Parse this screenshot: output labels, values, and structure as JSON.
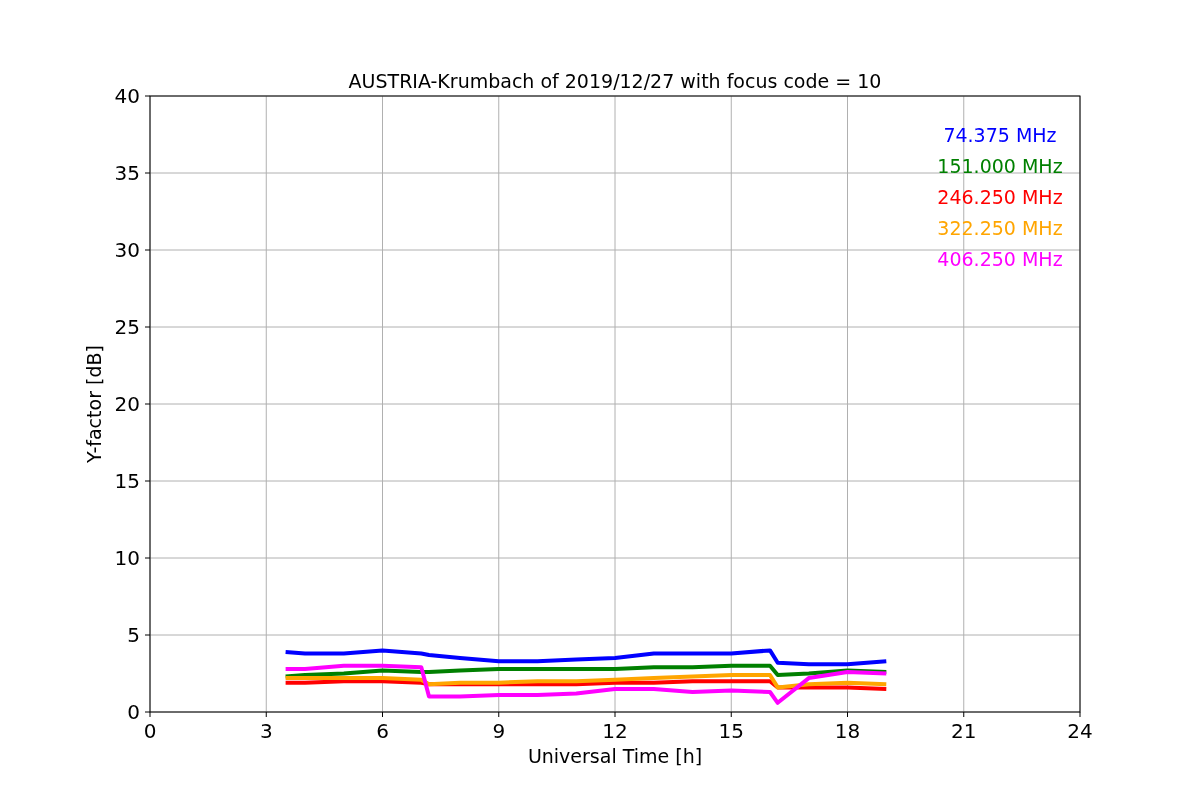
{
  "figure": {
    "chart_data": {
      "type": "line",
      "title": "AUSTRIA-Krumbach of 2019/12/27 with focus code = 10",
      "xlabel": "Universal Time [h]",
      "ylabel": "Y-factor [dB]",
      "x": [
        3.5,
        4,
        5,
        6,
        7,
        7.2,
        8,
        9,
        10,
        11,
        12,
        13,
        14,
        15,
        16,
        16.2,
        17,
        18,
        19
      ],
      "series": [
        {
          "name": "74.375 MHz",
          "color": "#0000ff",
          "values": [
            3.9,
            3.8,
            3.8,
            4.0,
            3.8,
            3.7,
            3.5,
            3.3,
            3.3,
            3.4,
            3.5,
            3.8,
            3.8,
            3.8,
            4.0,
            3.2,
            3.1,
            3.1,
            3.3
          ]
        },
        {
          "name": "151.000 MHz",
          "color": "#008000",
          "values": [
            2.3,
            2.4,
            2.5,
            2.7,
            2.6,
            2.6,
            2.7,
            2.8,
            2.8,
            2.8,
            2.8,
            2.9,
            2.9,
            3.0,
            3.0,
            2.4,
            2.5,
            2.7,
            2.6
          ]
        },
        {
          "name": "246.250 MHz",
          "color": "#ff0000",
          "values": [
            1.9,
            1.9,
            2.0,
            2.0,
            1.9,
            1.8,
            1.8,
            1.8,
            1.8,
            1.8,
            1.9,
            1.9,
            2.0,
            2.0,
            2.0,
            1.6,
            1.6,
            1.6,
            1.5
          ]
        },
        {
          "name": "322.250 MHz",
          "color": "#ffa500",
          "values": [
            2.2,
            2.2,
            2.2,
            2.2,
            2.1,
            1.8,
            1.9,
            1.9,
            2.0,
            2.0,
            2.1,
            2.2,
            2.3,
            2.4,
            2.4,
            1.6,
            1.8,
            1.9,
            1.8
          ]
        },
        {
          "name": "406.250 MHz",
          "color": "#ff00ff",
          "values": [
            2.8,
            2.8,
            3.0,
            3.0,
            2.9,
            1.0,
            1.0,
            1.1,
            1.1,
            1.2,
            1.5,
            1.5,
            1.3,
            1.4,
            1.3,
            0.6,
            2.2,
            2.6,
            2.5
          ]
        }
      ],
      "grid": true,
      "xlim": [
        0,
        24
      ],
      "ylim": [
        0,
        40
      ],
      "xticks": [
        0,
        3,
        6,
        9,
        12,
        15,
        18,
        21,
        24
      ],
      "yticks": [
        0,
        5,
        10,
        15,
        20,
        25,
        30,
        35,
        40
      ]
    }
  }
}
